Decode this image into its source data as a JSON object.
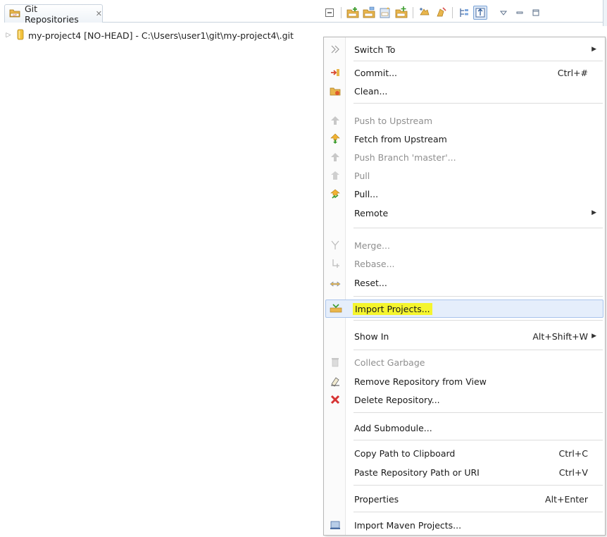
{
  "view": {
    "tab_title": "Git Repositories",
    "close_glyph": "✕"
  },
  "toolbar": {
    "buttons": [
      {
        "icon": "collapse-all-icon"
      },
      {
        "icon": "add-existing-repo-icon"
      },
      {
        "icon": "clone-repo-icon"
      },
      {
        "icon": "create-repo-icon"
      },
      {
        "icon": "add-repo-icon"
      },
      {
        "icon": "link-with-selection-icon"
      },
      {
        "icon": "refresh-icon"
      },
      {
        "icon": "hierarchical-layout-icon"
      },
      {
        "icon": "flat-layout-icon",
        "pressed": true
      },
      {
        "icon": "view-menu-icon"
      },
      {
        "icon": "minimize-icon"
      },
      {
        "icon": "maximize-icon"
      }
    ]
  },
  "tree": {
    "repository_label": "my-project4 [NO-HEAD] - C:\\Users\\user1\\git\\my-project4\\.git"
  },
  "context_menu": {
    "switch_to": "Switch To",
    "commit": "Commit...",
    "commit_shortcut": "Ctrl+#",
    "clean": "Clean...",
    "push_upstream": "Push to Upstream",
    "fetch_upstream": "Fetch from Upstream",
    "push_branch": "Push Branch 'master'...",
    "pull": "Pull",
    "pull_dialog": "Pull...",
    "remote": "Remote",
    "merge": "Merge...",
    "rebase": "Rebase...",
    "reset": "Reset...",
    "import_projects": "Import Projects...",
    "show_in": "Show In",
    "show_in_shortcut": "Alt+Shift+W",
    "collect_garbage": "Collect Garbage",
    "remove_repo": "Remove Repository from View",
    "delete_repo": "Delete Repository...",
    "add_submodule": "Add Submodule...",
    "copy_path": "Copy Path to Clipboard",
    "copy_path_shortcut": "Ctrl+C",
    "paste_path": "Paste Repository Path or URI",
    "paste_path_shortcut": "Ctrl+V",
    "properties": "Properties",
    "properties_shortcut": "Alt+Enter",
    "import_maven": "Import Maven Projects..."
  },
  "colors": {
    "highlight": "#f5f52e",
    "hover_bg": "#e5eefb",
    "disabled_text": "#8f8f8f"
  }
}
